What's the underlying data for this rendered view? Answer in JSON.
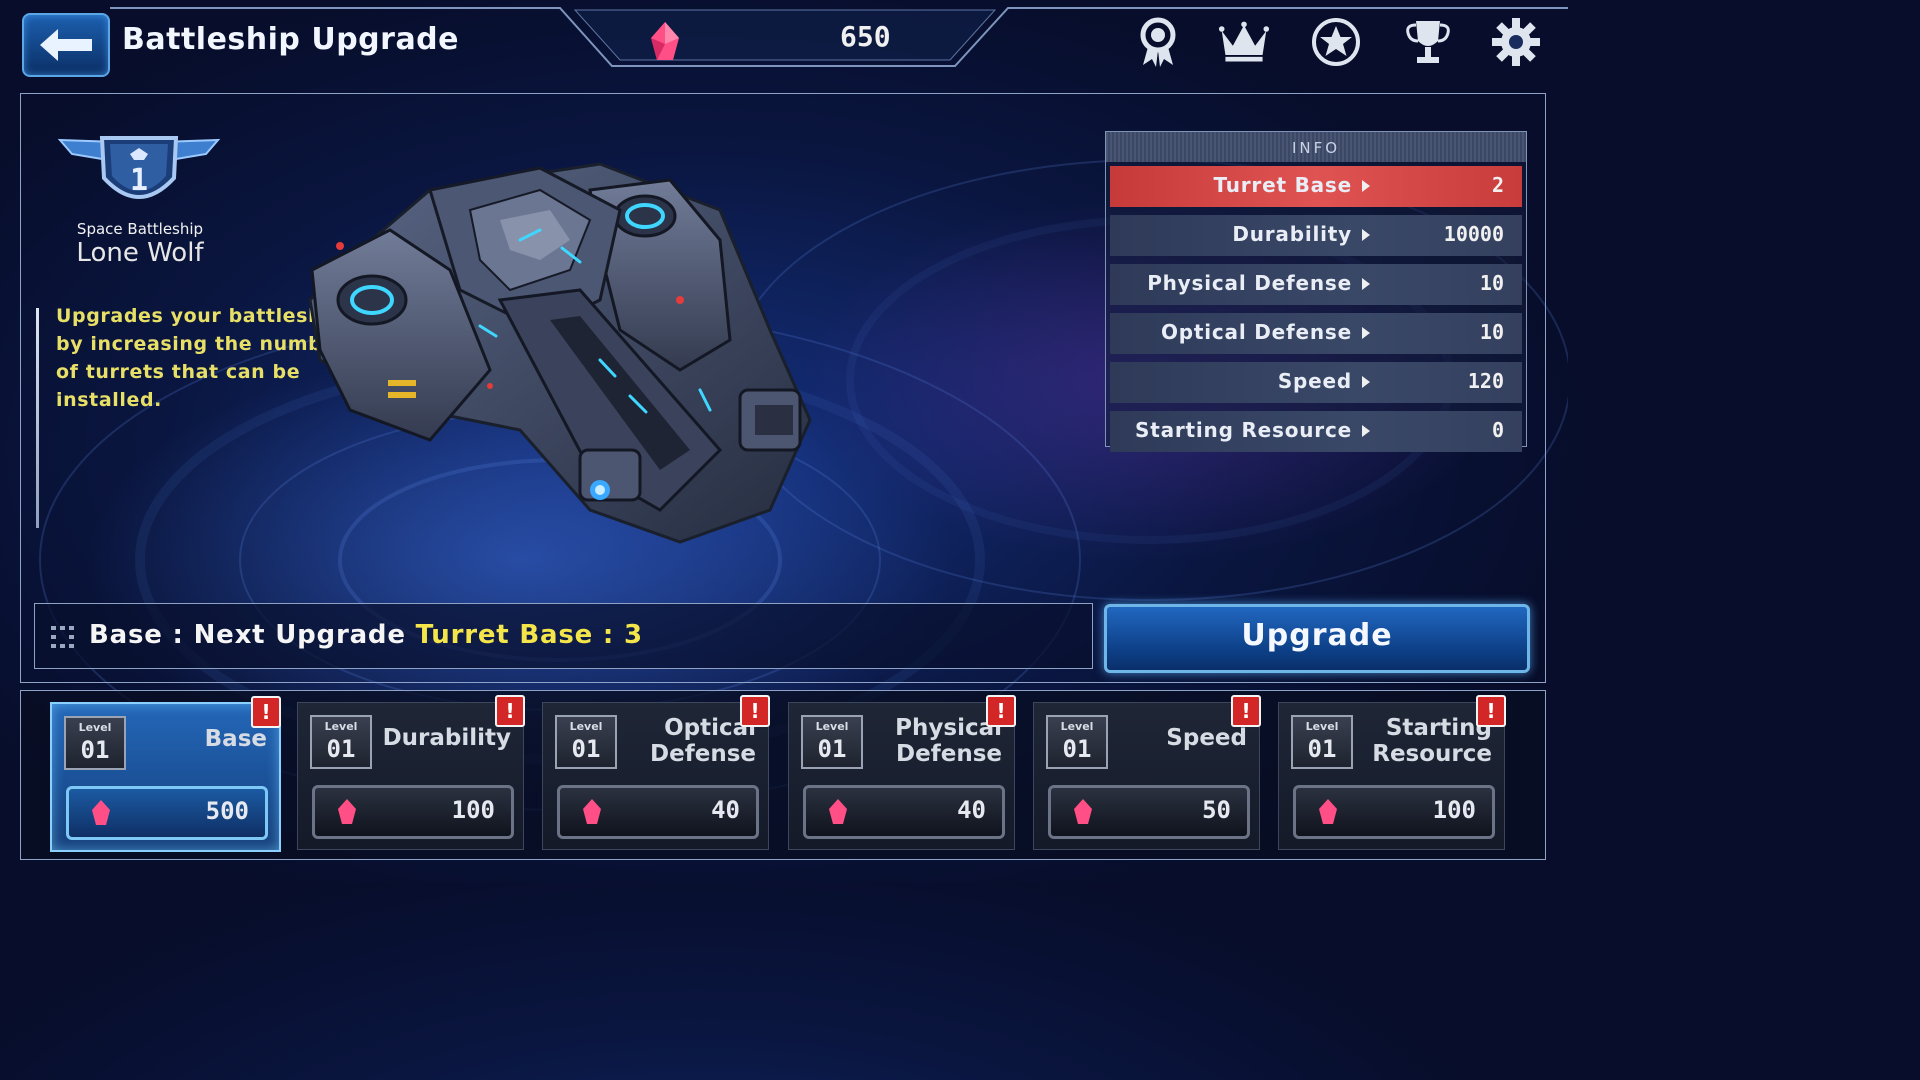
{
  "header": {
    "title": "Battleship Upgrade",
    "gem_count": "650"
  },
  "toolbar": {
    "icons": [
      "medal-icon",
      "crown-icon",
      "star-emblem-icon",
      "trophy-icon",
      "gear-icon"
    ]
  },
  "ship": {
    "level": "1",
    "class": "Space Battleship",
    "name": "Lone Wolf",
    "description": "Upgrades your battleship by increasing the number of turrets that can be installed."
  },
  "info": {
    "header": "INFO",
    "rows": [
      {
        "label": "Turret Base",
        "value": "2"
      },
      {
        "label": "Durability",
        "value": "10000"
      },
      {
        "label": "Physical Defense",
        "value": "10"
      },
      {
        "label": "Optical Defense",
        "value": "10"
      },
      {
        "label": "Speed",
        "value": "120"
      },
      {
        "label": "Starting Resource",
        "value": "0"
      }
    ]
  },
  "next_upgrade": {
    "prefix": "Base : Next Upgrade ",
    "highlight": "Turret Base : 3"
  },
  "upgrade_button": "Upgrade",
  "cards": [
    {
      "level_word": "Level",
      "level": "01",
      "name": "Base",
      "cost": "500",
      "alert": "!"
    },
    {
      "level_word": "Level",
      "level": "01",
      "name": "Durability",
      "cost": "100",
      "alert": "!"
    },
    {
      "level_word": "Level",
      "level": "01",
      "name": "Optical Defense",
      "name_l1": "Optical",
      "name_l2": "Defense",
      "cost": "40",
      "alert": "!"
    },
    {
      "level_word": "Level",
      "level": "01",
      "name": "Physical Defense",
      "name_l1": "Physical",
      "name_l2": "Defense",
      "cost": "40",
      "alert": "!"
    },
    {
      "level_word": "Level",
      "level": "01",
      "name": "Speed",
      "cost": "50",
      "alert": "!"
    },
    {
      "level_word": "Level",
      "level": "01",
      "name": "Starting Resource",
      "name_l1": "Starting",
      "name_l2": "Resource",
      "cost": "100",
      "alert": "!"
    }
  ],
  "colors": {
    "accent_red": "#e05353",
    "highlight_yellow": "#f4e64a",
    "description_yellow": "#e8e066",
    "gem_pink": "#ff5a8a"
  }
}
